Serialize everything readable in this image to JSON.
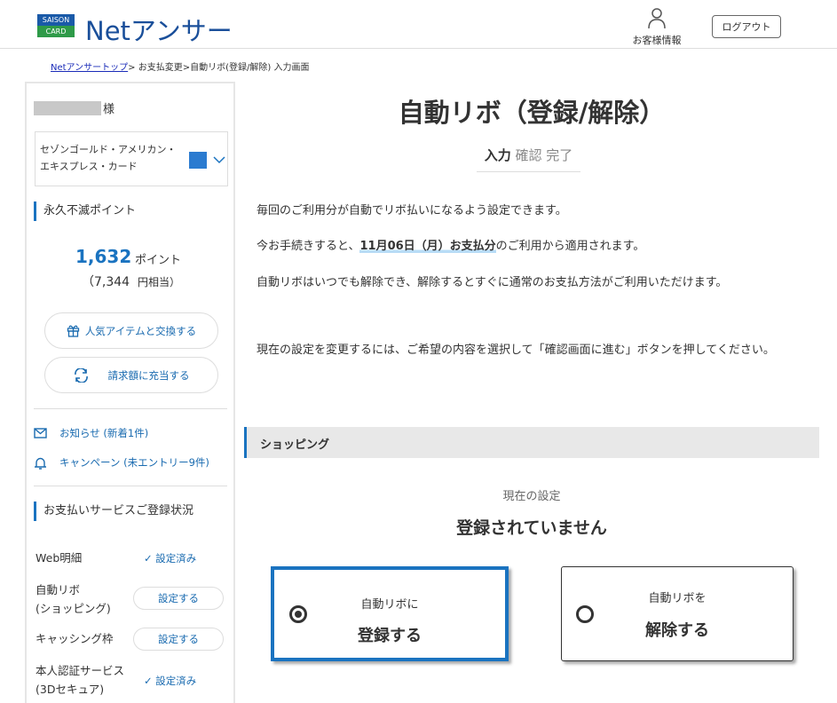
{
  "header": {
    "logo_badge_top": "SAISON",
    "logo_badge_bottom": "CARD",
    "logo_text": "Netアンサー",
    "customer_info": "お客様情報",
    "logout": "ログアウト"
  },
  "breadcrumb": {
    "home": "Netアンサートップ",
    "rest": "> お支払変更>自動リボ(登録/解除) 入力画面"
  },
  "sidebar": {
    "honorific": "様",
    "card_name": "セゾンゴールド・アメリカン・エキスプレス・カード",
    "points_title": "永久不滅ポイント",
    "points_value": "1,632",
    "points_unit": "ポイント",
    "yen_value": "（7,344",
    "yen_unit": "円相当）",
    "exchange_button": "人気アイテムと交換する",
    "apply_button": "請求額に充当する",
    "notice_link": "お知らせ (新着1件)",
    "campaign_link": "キャンペーン (未エントリー9件)",
    "services_title": "お支払いサービスご登録状況",
    "services": [
      {
        "label": "Web明細",
        "status": "設定済み"
      },
      {
        "label": "自動リボ\n(ショッピング)",
        "status": "設定する"
      },
      {
        "label": "キャッシング枠",
        "status": "設定する"
      },
      {
        "label": "本人認証サービス\n(3Dセキュア)",
        "status": "設定済み"
      }
    ]
  },
  "main": {
    "title": "自動リボ（登録/解除）",
    "steps": [
      "入力",
      "確認",
      "完了"
    ],
    "para1": "毎回のご利用分が自動でリボ払いになるよう設定できます。",
    "para2_pre": "今お手続きすると、",
    "para2_highlight": "11月06日（月）お支払分",
    "para2_post": "のご利用から適用されます。",
    "para3": "自動リボはいつでも解除でき、解除するとすぐに通常のお支払方法がご利用いただけます。",
    "para4": "現在の設定を変更するには、ご希望の内容を選択して「確認画面に進む」ボタンを押してください。",
    "section_title": "ショッピング",
    "current_label": "現在の設定",
    "current_value": "登録されていません",
    "option_register_small": "自動リボに",
    "option_register_big": "登録する",
    "option_cancel_small": "自動リボを",
    "option_cancel_big": "解除する",
    "selected_option": "register"
  },
  "colors": {
    "accent": "#1a73c0",
    "logo": "#1a4f9a"
  }
}
